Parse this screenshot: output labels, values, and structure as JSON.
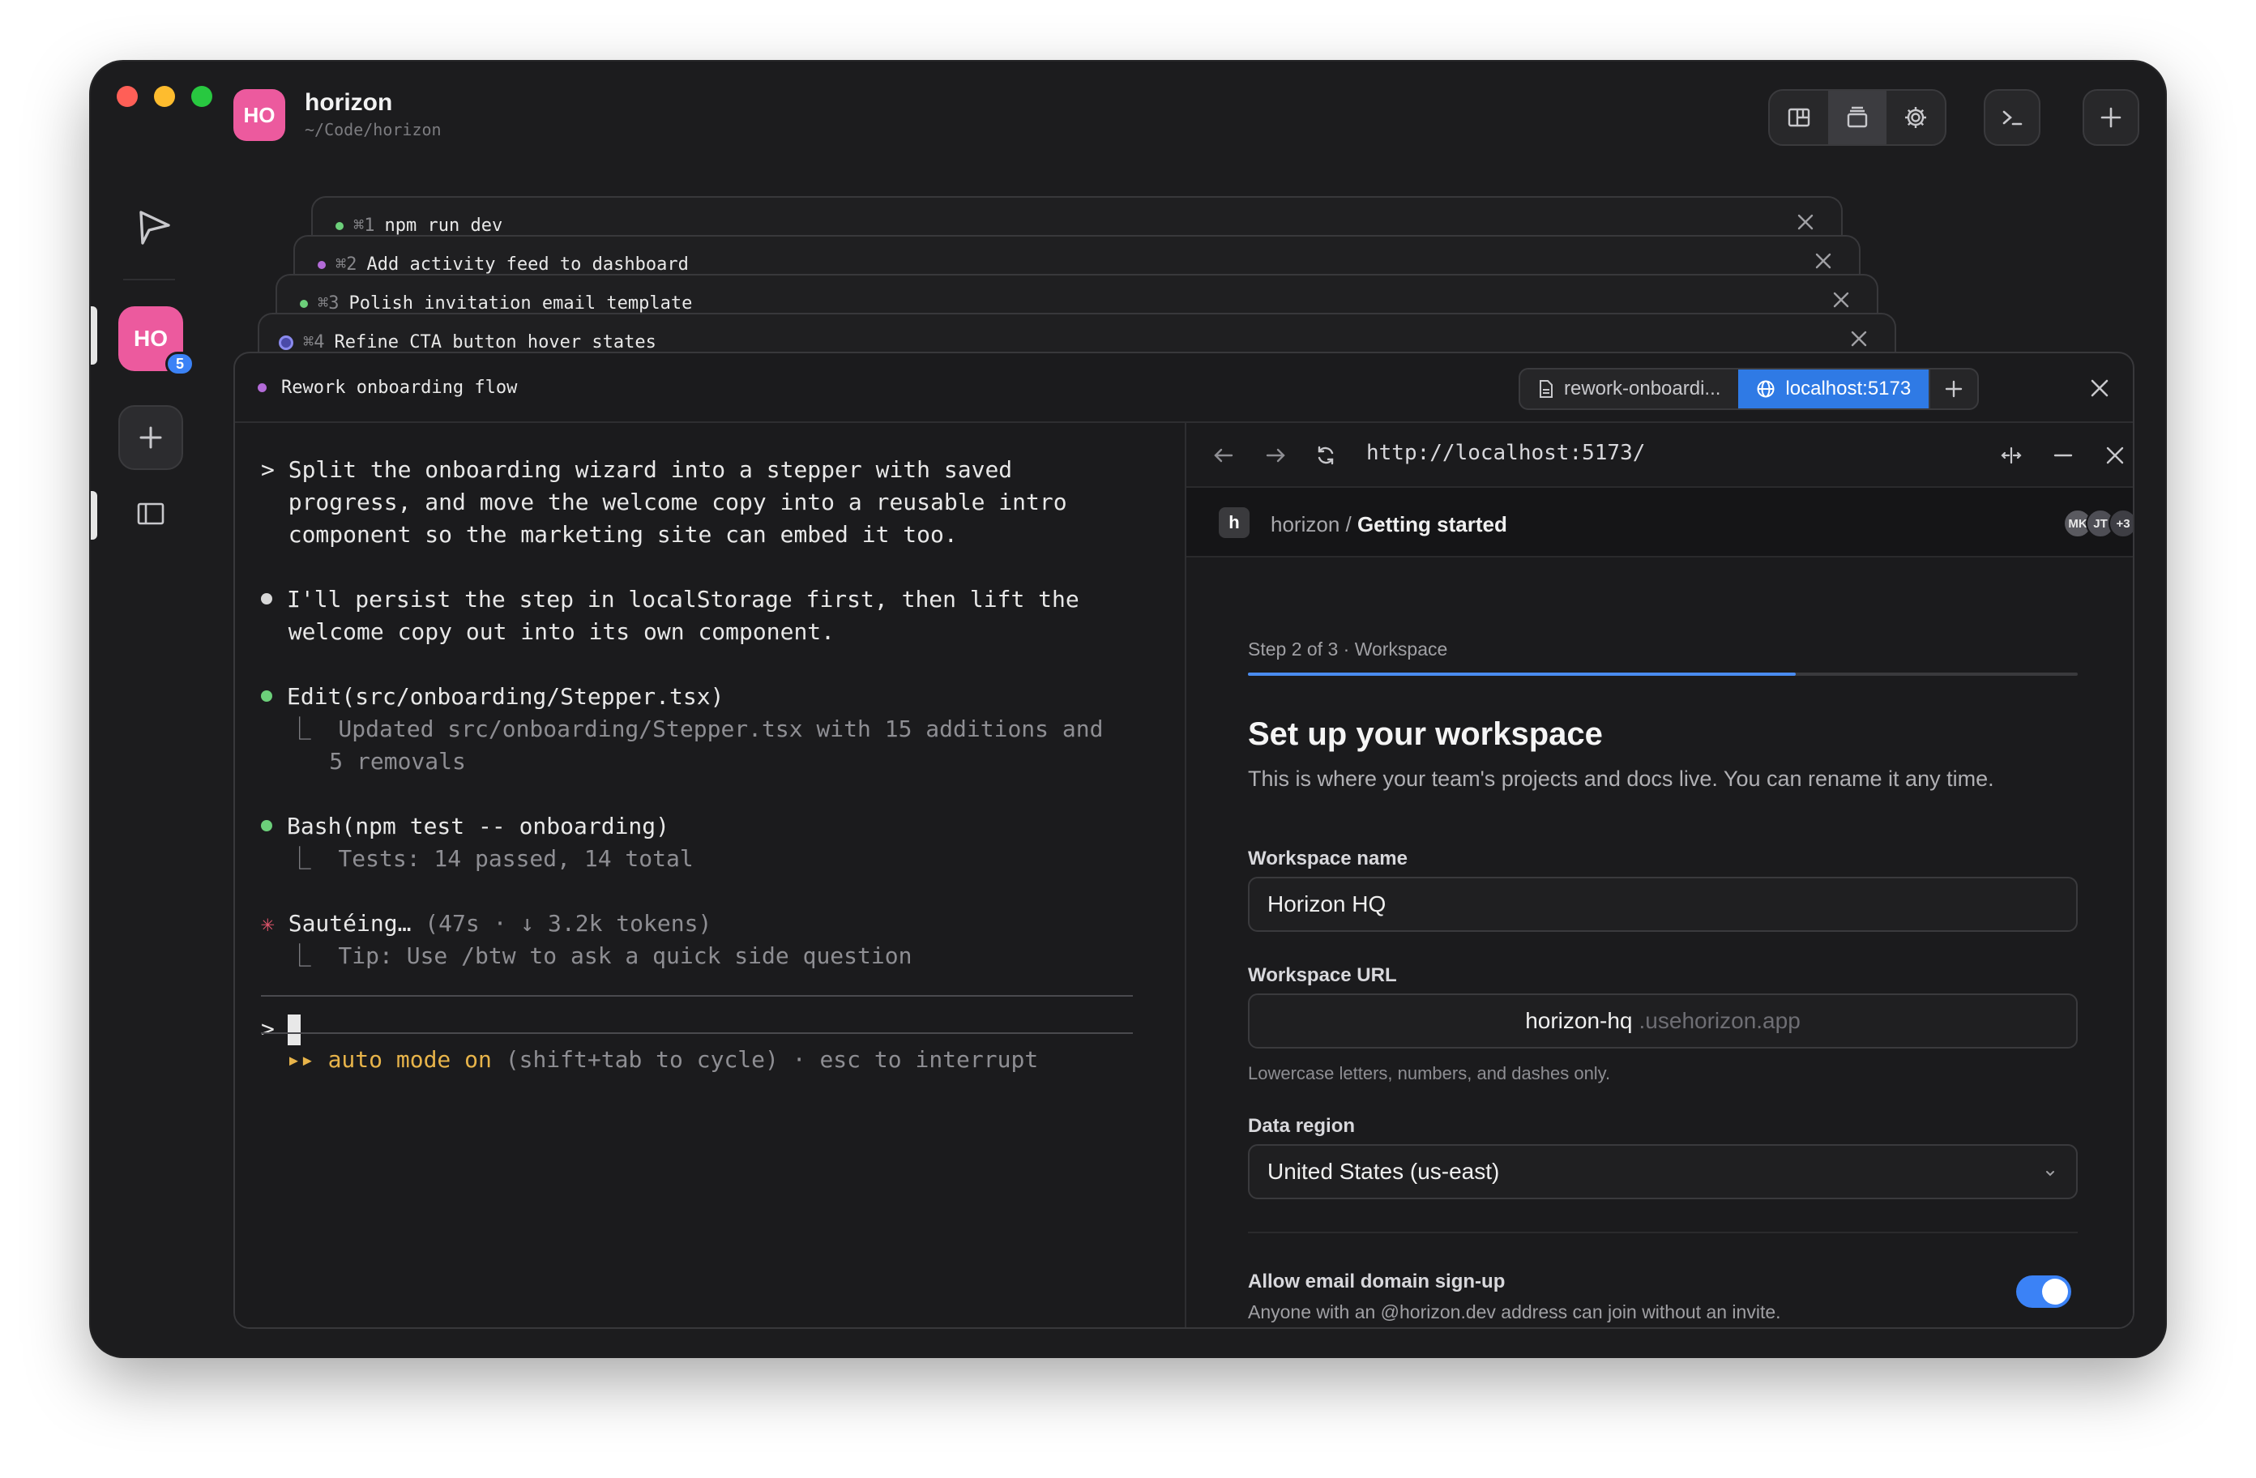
{
  "project": {
    "avatar": "HO",
    "name": "horizon",
    "path": "~/Code/horizon"
  },
  "sidebar": {
    "avatar": "HO",
    "badge": "5"
  },
  "stacked_tabs": [
    {
      "key": "⌘1",
      "label": "npm run dev",
      "dot": "#6ccf7a"
    },
    {
      "key": "⌘2",
      "label": "Add activity feed to dashboard",
      "dot": "#b36bd8"
    },
    {
      "key": "⌘3",
      "label": "Polish invitation email template",
      "dot": "#6ccf7a"
    },
    {
      "key": "⌘4",
      "label": "Refine CTA button hover states",
      "dot": "#8a8aee"
    }
  ],
  "panel": {
    "title": "Rework onboarding flow",
    "tabs": [
      {
        "label": "rework-onboardi...",
        "icon": "file-icon",
        "active": false
      },
      {
        "label": "localhost:5173",
        "icon": "globe-icon",
        "active": true
      }
    ]
  },
  "terminal": {
    "prompt_lines": [
      "> Split the onboarding wizard into a stepper with saved",
      "  progress, and move the welcome copy into a reusable intro",
      "  component so the marketing site can embed it too."
    ],
    "reply_lines": [
      "I'll persist the step in localStorage first, then lift the",
      "  welcome copy out into its own component."
    ],
    "edit": {
      "call": "Edit(src/onboarding/Stepper.tsx)",
      "result1": "  ⎿  Updated src/onboarding/Stepper.tsx with 15 additions and",
      "result2": "     5 removals"
    },
    "bash": {
      "call": "Bash(npm test -- onboarding)",
      "result": "  ⎿  Tests: 14 passed, 14 total"
    },
    "status": {
      "verb": "Sautéing…",
      "meta": " (47s · ↓ 3.2k tokens)",
      "tip": "  ⎿  Tip: Use /btw to ask a quick side question"
    },
    "input_prompt": ">",
    "footer_mode": "▸▸ auto mode on",
    "footer_rest": " (shift+tab to cycle) · esc to interrupt"
  },
  "browser": {
    "url": "http://localhost:5173/",
    "site_logo": "h",
    "crumb_parent": "horizon / ",
    "crumb_current": "Getting started",
    "avatars": [
      "MK",
      "JT",
      "+3"
    ],
    "step_label": "Step 2 of 3 · Workspace",
    "progress": 0.66,
    "heading": "Set up your workspace",
    "subheading": "This is where your team's projects and docs live. You can rename it any time.",
    "workspace_name_label": "Workspace name",
    "workspace_name_value": "Horizon HQ",
    "workspace_url_label": "Workspace URL",
    "workspace_url_value": "horizon-hq",
    "workspace_url_suffix": ".usehorizon.app",
    "workspace_url_hint": "Lowercase letters, numbers, and dashes only.",
    "region_label": "Data region",
    "region_value": "United States (us-east)",
    "signup_label": "Allow email domain sign-up",
    "signup_desc": "Anyone with an @horizon.dev address can join without an invite.",
    "signup_enabled": true
  },
  "colors": {
    "accent": "#2f7ae5",
    "brand": "#ec5a9e",
    "toggle": "#3b82f6",
    "auto_mode": "#e8b44a"
  }
}
